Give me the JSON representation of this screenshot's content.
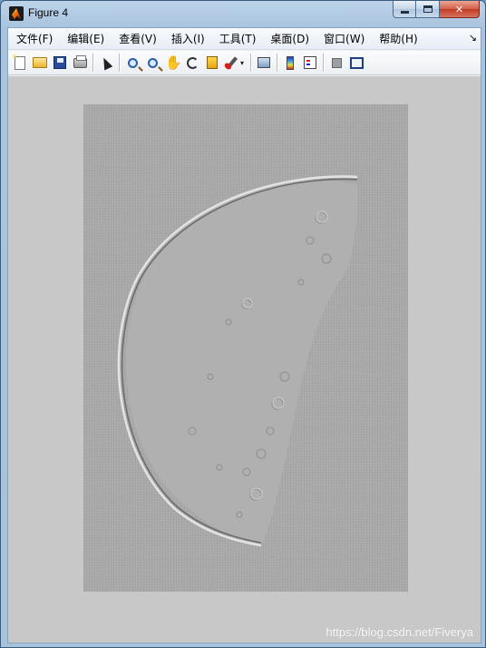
{
  "window": {
    "title": "Figure 4"
  },
  "menu": {
    "items": [
      {
        "label": "文件(F)"
      },
      {
        "label": "编辑(E)"
      },
      {
        "label": "查看(V)"
      },
      {
        "label": "插入(I)"
      },
      {
        "label": "工具(T)"
      },
      {
        "label": "桌面(D)"
      },
      {
        "label": "窗口(W)"
      },
      {
        "label": "帮助(H)"
      }
    ],
    "dock_arrow": "↘"
  },
  "toolbar": {
    "icons": [
      "new-figure-icon",
      "open-file-icon",
      "save-icon",
      "print-icon",
      "edit-plot-arrow-icon",
      "zoom-in-icon",
      "zoom-out-icon",
      "pan-hand-icon",
      "rotate-3d-icon",
      "data-cursor-icon",
      "brush-icon",
      "link-plot-icon",
      "colorbar-icon",
      "legend-icon",
      "hide-plot-tools-icon",
      "show-plot-tools-icon"
    ],
    "dropdown_glyph": "▾"
  },
  "colors": {
    "figure_background": "#c8c8c8",
    "image_background": "#a7a7a7"
  },
  "watermark": {
    "text": "https://blog.csdn.net/Fiverya"
  }
}
